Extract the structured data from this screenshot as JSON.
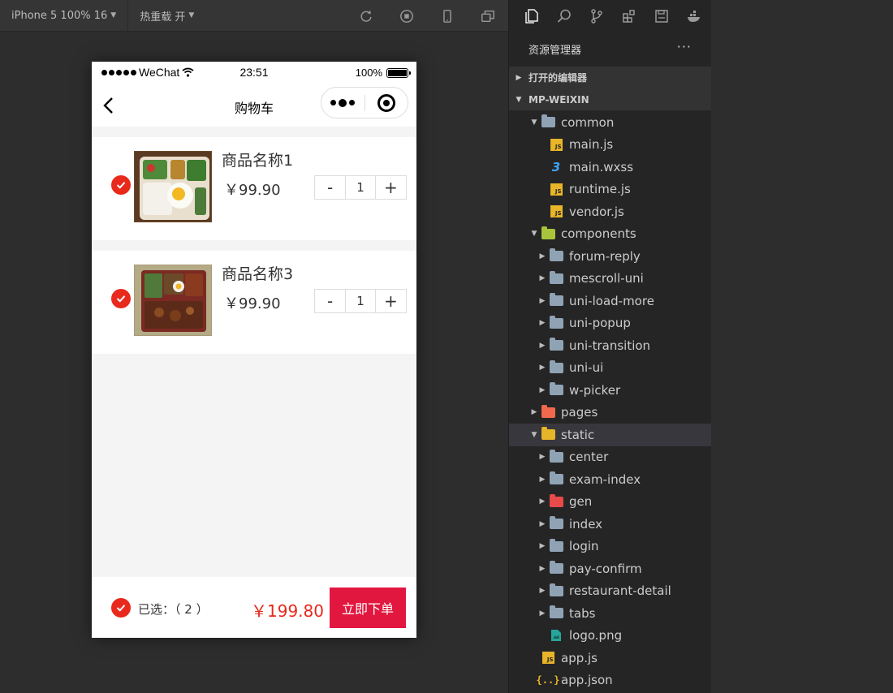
{
  "toolbar": {
    "device_label": "iPhone 5 100% 16",
    "hot_reload_label": "热重载 开",
    "icons": [
      "refresh-icon",
      "stop-icon",
      "phone-icon",
      "window-icon"
    ]
  },
  "phone": {
    "status": {
      "carrier": "WeChat",
      "time": "23:51",
      "battery": "100%"
    },
    "nav": {
      "title": "购物车"
    },
    "items": [
      {
        "name": "商品名称1",
        "price": "￥99.90",
        "qty": "1",
        "minus": "-",
        "plus": "+"
      },
      {
        "name": "商品名称3",
        "price": "￥99.90",
        "qty": "1",
        "minus": "-",
        "plus": "+"
      }
    ],
    "bottom": {
      "selected_text": "已选：（ 2 ）",
      "total": "￥199.80",
      "order_button": "立即下单"
    }
  },
  "explorer": {
    "title": "资源管理器",
    "more": "···",
    "open_editors": "打开的编辑器",
    "project": "MP-WEIXIN",
    "tree": [
      {
        "label": "common",
        "type": "folder-open",
        "level": 0
      },
      {
        "label": "main.js",
        "type": "js",
        "level": 1
      },
      {
        "label": "main.wxss",
        "type": "css",
        "level": 1
      },
      {
        "label": "runtime.js",
        "type": "js",
        "level": 1
      },
      {
        "label": "vendor.js",
        "type": "js",
        "level": 1
      },
      {
        "label": "components",
        "type": "folder-open-green",
        "level": 0
      },
      {
        "label": "forum-reply",
        "type": "folder",
        "level": 1
      },
      {
        "label": "mescroll-uni",
        "type": "folder",
        "level": 1
      },
      {
        "label": "uni-load-more",
        "type": "folder",
        "level": 1
      },
      {
        "label": "uni-popup",
        "type": "folder",
        "level": 1
      },
      {
        "label": "uni-transition",
        "type": "folder",
        "level": 1
      },
      {
        "label": "uni-ui",
        "type": "folder",
        "level": 1
      },
      {
        "label": "w-picker",
        "type": "folder",
        "level": 1
      },
      {
        "label": "pages",
        "type": "folder-pages",
        "level": 0
      },
      {
        "label": "static",
        "type": "folder-open-yellow",
        "level": 0,
        "selected": true
      },
      {
        "label": "center",
        "type": "folder",
        "level": 1
      },
      {
        "label": "exam-index",
        "type": "folder",
        "level": 1
      },
      {
        "label": "gen",
        "type": "folder-red",
        "level": 1
      },
      {
        "label": "index",
        "type": "folder",
        "level": 1
      },
      {
        "label": "login",
        "type": "folder",
        "level": 1
      },
      {
        "label": "pay-confirm",
        "type": "folder",
        "level": 1
      },
      {
        "label": "restaurant-detail",
        "type": "folder",
        "level": 1
      },
      {
        "label": "tabs",
        "type": "folder",
        "level": 1
      },
      {
        "label": "logo.png",
        "type": "image",
        "level": 1
      },
      {
        "label": "app.js",
        "type": "js",
        "level": 0
      },
      {
        "label": "app.json",
        "type": "json",
        "level": 0
      }
    ]
  },
  "colors": {
    "accent_red": "#e8291c",
    "order_button": "#e2173f",
    "explorer_bg": "#252526"
  }
}
